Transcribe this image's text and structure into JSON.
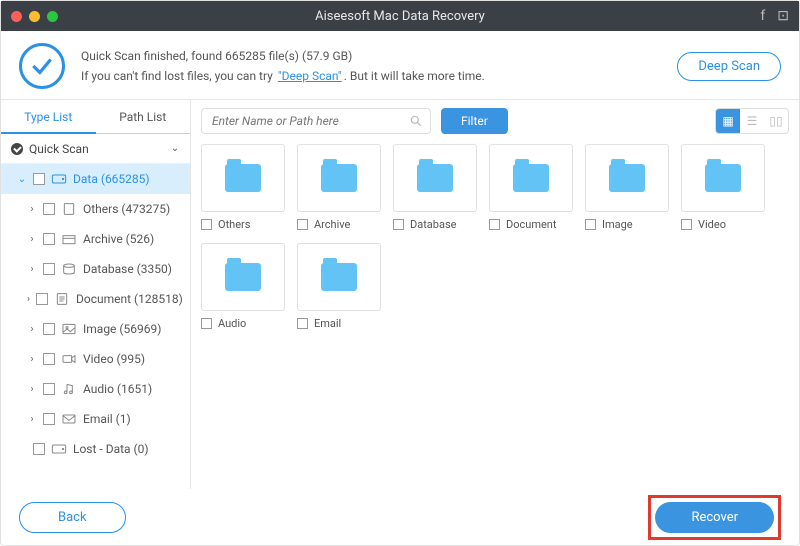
{
  "titlebar": {
    "title": "Aiseesoft Mac Data Recovery"
  },
  "scan": {
    "result": "Quick Scan finished, found 665285 file(s) (57.9 GB)",
    "hint_a": "If you can't find lost files, you can try",
    "deep_link": "\"Deep Scan\"",
    "hint_b": ". But it will take more time.",
    "deep_btn": "Deep Scan"
  },
  "tabs": {
    "type": "Type List",
    "path": "Path List"
  },
  "quick_scan": "Quick Scan",
  "tree": {
    "data": "Data (665285)",
    "others": "Others (473275)",
    "archive": "Archive (526)",
    "database": "Database (3350)",
    "document": "Document (128518)",
    "image": "Image (56969)",
    "video": "Video (995)",
    "audio": "Audio (1651)",
    "email": "Email (1)",
    "lost": "Lost - Data (0)"
  },
  "search": {
    "placeholder": "Enter Name or Path here"
  },
  "filter": "Filter",
  "tiles": {
    "others": "Others",
    "archive": "Archive",
    "database": "Database",
    "document": "Document",
    "image": "Image",
    "video": "Video",
    "audio": "Audio",
    "email": "Email"
  },
  "footer": {
    "back": "Back",
    "recover": "Recover"
  }
}
